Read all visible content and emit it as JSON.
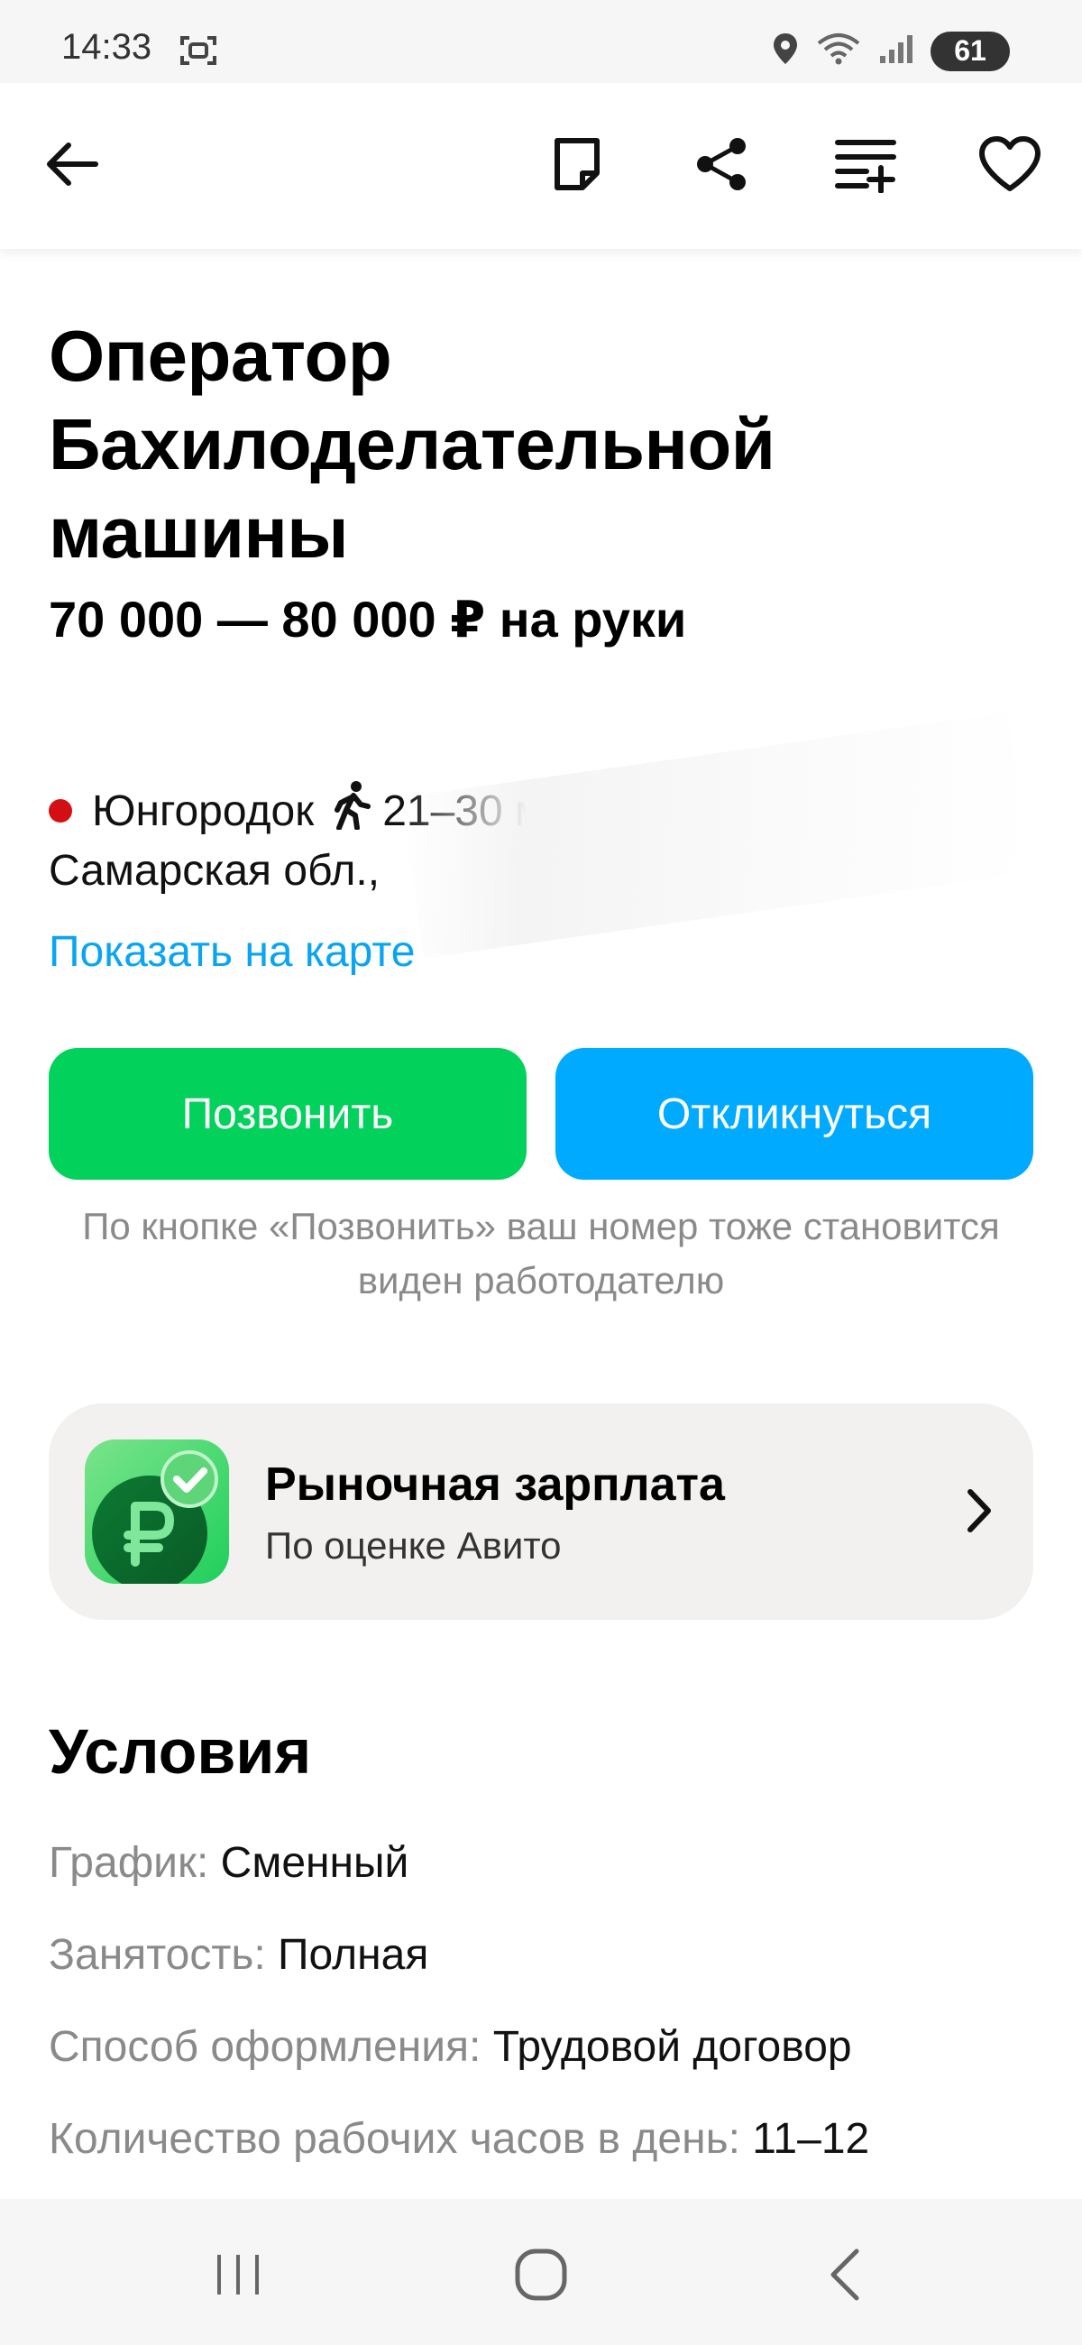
{
  "status_bar": {
    "time": "14:33",
    "battery": "61",
    "icons": [
      "screenshot-icon",
      "location-icon",
      "wifi-icon",
      "signal-icon"
    ]
  },
  "toolbar": {
    "icons": [
      "back-arrow-icon",
      "note-icon",
      "share-icon",
      "add-to-list-icon",
      "heart-icon"
    ]
  },
  "vacancy": {
    "title": "Оператор Бахилоделательной машины",
    "salary": "70 000 — 80 000 ₽ на руки"
  },
  "location": {
    "metro": "Юнгородок",
    "walk_time": "21–30 мин",
    "address": "Самарская обл.,",
    "map_link": "Показать на карте",
    "metro_color": "#d40f14"
  },
  "actions": {
    "call_label": "Позвонить",
    "apply_label": "Откликнуться",
    "note": "По кнопке «Позвонить» ваш номер тоже становится виден работодателю"
  },
  "market_salary": {
    "title": "Рыночная зарплата",
    "subtitle": "По оценке Авито"
  },
  "conditions": {
    "heading": "Условия",
    "items": [
      {
        "label": "График:",
        "value": "Сменный"
      },
      {
        "label": "Занятость:",
        "value": "Полная"
      },
      {
        "label": "Способ оформления:",
        "value": "Трудовой договор"
      },
      {
        "label": "Количество рабочих часов в день:",
        "value": "11–12"
      }
    ]
  },
  "nav_bar": {
    "icons": [
      "recent-apps-icon",
      "home-icon",
      "back-icon"
    ]
  },
  "colors": {
    "call_button": "#02d15c",
    "apply_button": "#00aaff",
    "link": "#0aa5f0"
  }
}
